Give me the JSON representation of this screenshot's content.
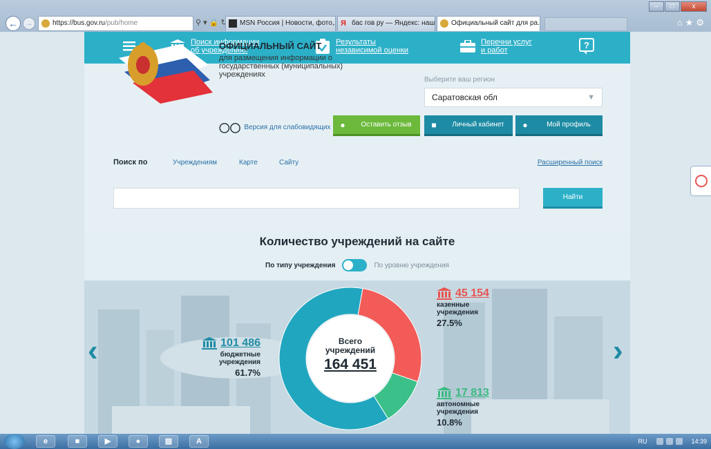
{
  "browser": {
    "address_host": "https://bus.gov.ru",
    "address_path": "/pub/home",
    "tabs": [
      {
        "label": "MSN Россия | Новости, фото,..."
      },
      {
        "label": "бас гов ру — Яндекс: нашлос..."
      },
      {
        "label": "Официальный сайт для ра... ×"
      }
    ],
    "window_controls": {
      "minimize": "–",
      "maximize": "□",
      "close": "x"
    }
  },
  "topbar": {
    "search_info": "Поиск информации об учреждениях",
    "ratings": "Результаты независимой оценки",
    "services": "Перечни услуг и работ",
    "help_icon": "?"
  },
  "header": {
    "title": "ОФИЦИАЛЬНЫЙ САЙТ",
    "description": "для размещения информации о государственных (муниципальных) учреждениях",
    "low_vision": "Версия для слабовидящих",
    "region_label": "Выберите ваш регион",
    "region_value": "Саратовская обл"
  },
  "buttons": {
    "feedback": "Оставить отзыв",
    "cabinet": "Личный кабинет",
    "profile": "Мой профиль"
  },
  "search": {
    "by_label": "Поиск по",
    "links": [
      "Учреждениям",
      "Карте",
      "Сайту"
    ],
    "advanced": "Расширенный поиск",
    "submit": "Найти"
  },
  "stats": {
    "title": "Количество учреждений на сайте",
    "toggle_left": "По типу учреждения",
    "toggle_right": "По уровню учреждения",
    "total_label": "Всего учреждений",
    "total_value": "164 451",
    "budget": {
      "number": "101 486",
      "name": "бюджетные учреждения",
      "percent": "61.7%"
    },
    "government": {
      "number": "45 154",
      "name": "казенные учреждения",
      "percent": "27.5%"
    },
    "autonomous": {
      "number": "17 813",
      "name": "автономные учреждения",
      "percent": "10.8%"
    },
    "shares": [
      {
        "name": "бюджетные учреждения",
        "share": 0.617,
        "color": "#21a6bf"
      },
      {
        "name": "казенные учреждения",
        "share": 0.275,
        "color": "#f25b58"
      },
      {
        "name": "автономные учреждения",
        "share": 0.108,
        "color": "#3cc08a"
      }
    ]
  },
  "taskbar": {
    "lang": "RU",
    "time": "14:39"
  }
}
